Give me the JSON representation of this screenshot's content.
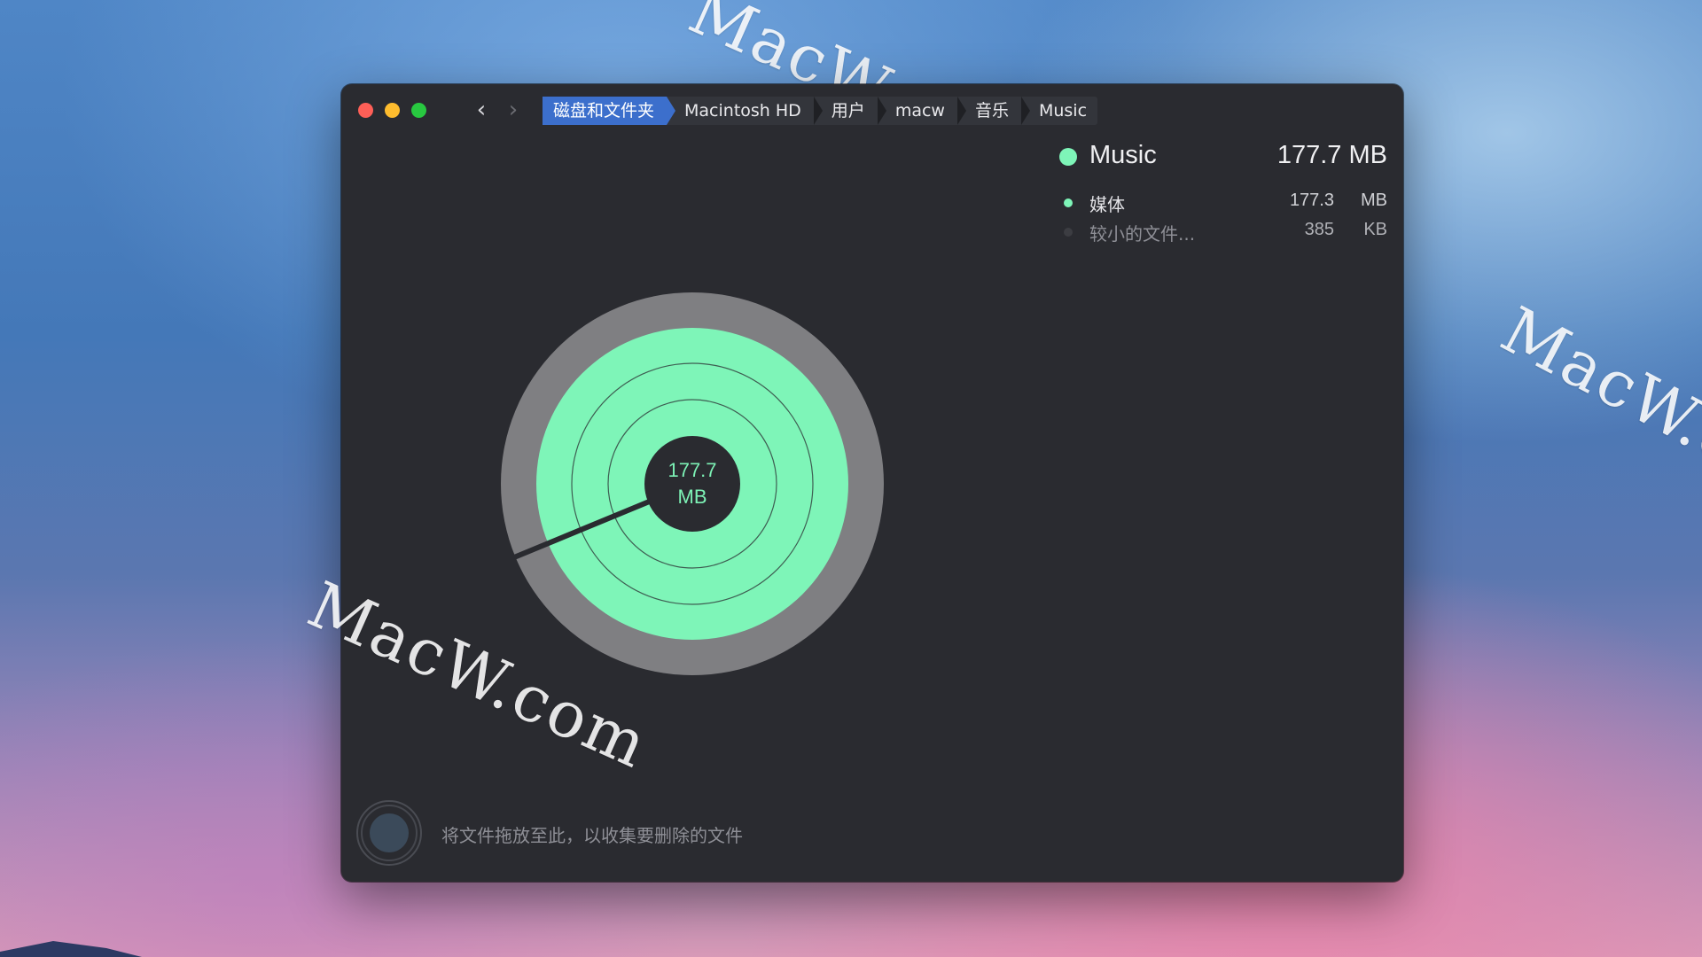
{
  "breadcrumb": [
    "磁盘和文件夹",
    "Macintosh HD",
    "用户",
    "macw",
    "音乐",
    "Music"
  ],
  "summary": {
    "name": "Music",
    "size": "177.7 MB"
  },
  "items": [
    {
      "label": "媒体",
      "size_value": "177.3",
      "size_unit": "MB",
      "fraction": 0.9978
    },
    {
      "label": "较小的文件...",
      "size_value": "385",
      "size_unit": "KB",
      "fraction": 0.0022
    }
  ],
  "center": {
    "value": "177.7",
    "unit": "MB"
  },
  "drop_hint": "将文件拖放至此，以收集要删除的文件",
  "watermark": "MacW.com",
  "colors": {
    "accent_green": "#7ef5b8",
    "ring_gray": "#7f7f82",
    "selected_crumb": "#3c6fcc",
    "window_bg": "#2a2b30"
  },
  "icons": {
    "back": "chevron-left",
    "forward": "chevron-right"
  }
}
